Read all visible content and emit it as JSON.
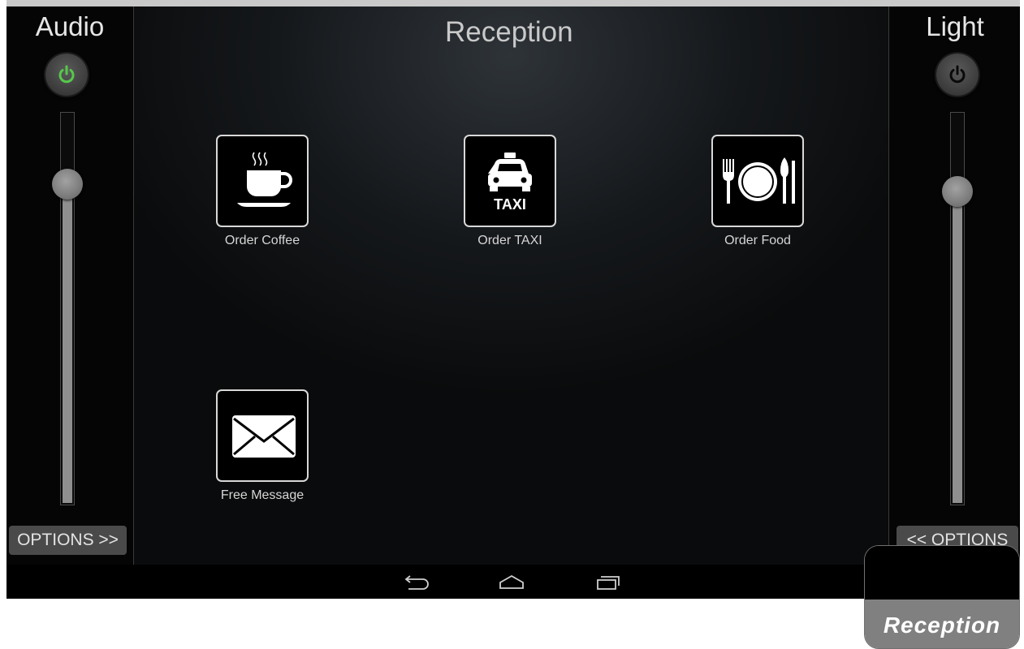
{
  "screen": {
    "title": "Reception"
  },
  "audio": {
    "title": "Audio",
    "power_on": true,
    "power_color": "#56c84a",
    "level": 0.82,
    "options_label": "OPTIONS >>"
  },
  "light": {
    "title": "Light",
    "power_on": false,
    "power_color": "#0a0a0a",
    "level": 0.8,
    "options_label": "<< OPTIONS"
  },
  "tiles": [
    {
      "label": "Order Coffee",
      "icon": "coffee-cup-icon"
    },
    {
      "label": "Order TAXI",
      "icon": "taxi-icon",
      "icon_text": "TAXI"
    },
    {
      "label": "Order Food",
      "icon": "plate-cutlery-icon"
    },
    {
      "label": "Free Message",
      "icon": "envelope-icon"
    }
  ],
  "navbar": {
    "icons": [
      "back-icon",
      "home-icon",
      "recent-apps-icon"
    ]
  },
  "caption": {
    "text": "Reception"
  }
}
